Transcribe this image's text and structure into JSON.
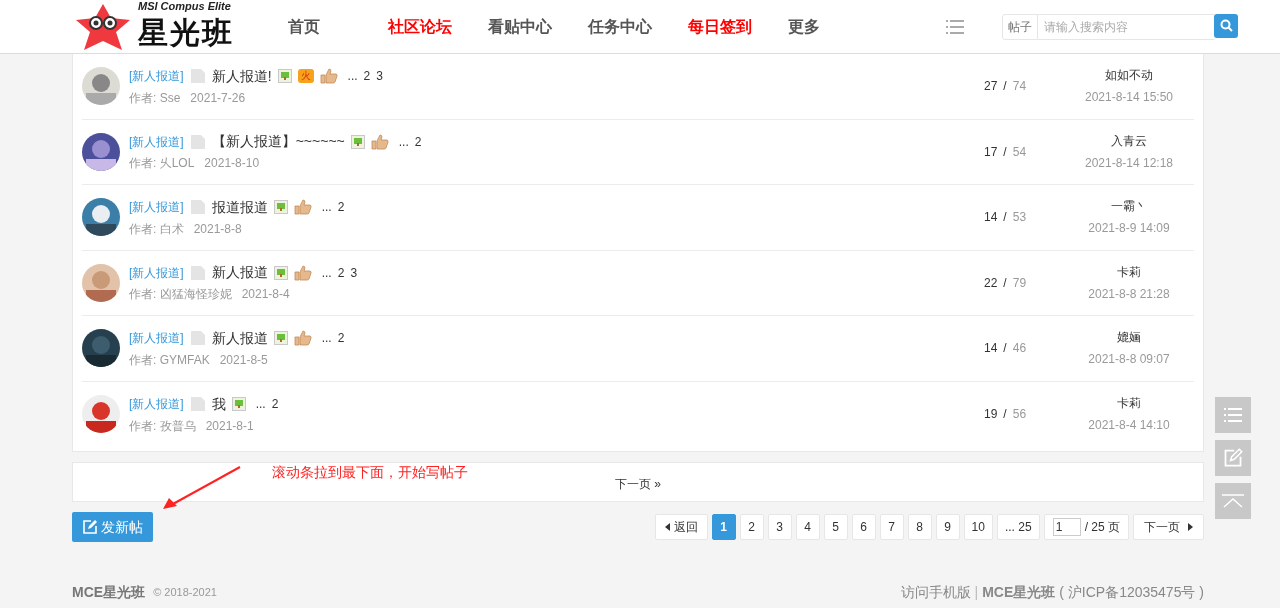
{
  "header": {
    "logo_caption": "MSI Compus Elite",
    "logo_title": "星光班",
    "nav": [
      {
        "label": "首页",
        "highlighted": false
      },
      {
        "label": "社区论坛",
        "highlighted": true
      },
      {
        "label": "看贴中心",
        "highlighted": false
      },
      {
        "label": "任务中心",
        "highlighted": false
      },
      {
        "label": "每日签到",
        "highlighted": true
      },
      {
        "label": "更多",
        "highlighted": false
      }
    ],
    "search": {
      "scope": "帖子",
      "placeholder": "请输入搜索内容"
    }
  },
  "threads": [
    {
      "category": "[新人报道]",
      "title": "新人报道!",
      "image": true,
      "hot": "火",
      "liked": true,
      "page_ellipsis": "...",
      "pages": [
        "2",
        "3"
      ],
      "author": "作者: Sse",
      "date": "2021-7-26",
      "replies": "27",
      "sep": "/",
      "views": "74",
      "last_poster": "如如不动",
      "last_time": "2021-8-14 15:50"
    },
    {
      "category": "[新人报道]",
      "title": "【新人报道】~~~~~~",
      "image": true,
      "liked": true,
      "page_ellipsis": "...",
      "pages": [
        "2"
      ],
      "author": "作者: 乆LOL",
      "date": "2021-8-10",
      "replies": "17",
      "sep": "/",
      "views": "54",
      "last_poster": "入青云",
      "last_time": "2021-8-14 12:18"
    },
    {
      "category": "[新人报道]",
      "title": "报道报道",
      "image": true,
      "liked": true,
      "page_ellipsis": "...",
      "pages": [
        "2"
      ],
      "author": "作者: 白术",
      "date": "2021-8-8",
      "replies": "14",
      "sep": "/",
      "views": "53",
      "last_poster": "一霸丶",
      "last_time": "2021-8-9 14:09"
    },
    {
      "category": "[新人报道]",
      "title": "新人报道",
      "image": true,
      "liked": true,
      "page_ellipsis": "...",
      "pages": [
        "2",
        "3"
      ],
      "author": "作者: 凶猛海怪珍妮",
      "date": "2021-8-4",
      "replies": "22",
      "sep": "/",
      "views": "79",
      "last_poster": "卡莉",
      "last_time": "2021-8-8 21:28"
    },
    {
      "category": "[新人报道]",
      "title": "新人报道",
      "image": true,
      "liked": true,
      "page_ellipsis": "...",
      "pages": [
        "2"
      ],
      "author": "作者: GYMFAK",
      "date": "2021-8-5",
      "replies": "14",
      "sep": "/",
      "views": "46",
      "last_poster": "媲婳",
      "last_time": "2021-8-8 09:07"
    },
    {
      "category": "[新人报道]",
      "title": "我",
      "image": true,
      "liked": false,
      "page_ellipsis": "...",
      "pages": [
        "2"
      ],
      "author": "作者: 孜普乌",
      "date": "2021-8-1",
      "replies": "19",
      "sep": "/",
      "views": "56",
      "last_poster": "卡莉",
      "last_time": "2021-8-4 14:10"
    }
  ],
  "next_page_bar": "下一页 »",
  "annotation": "滚动条拉到最下面，开始写帖子",
  "new_post_button": "发新帖",
  "pagination": {
    "back": "返回",
    "pages": [
      {
        "label": "1",
        "selected": true
      },
      {
        "label": "2",
        "selected": false
      },
      {
        "label": "3",
        "selected": false
      },
      {
        "label": "4",
        "selected": false
      },
      {
        "label": "5",
        "selected": false
      },
      {
        "label": "6",
        "selected": false
      },
      {
        "label": "7",
        "selected": false
      },
      {
        "label": "8",
        "selected": false
      },
      {
        "label": "9",
        "selected": false
      },
      {
        "label": "10",
        "selected": false
      },
      {
        "label": "... 25",
        "selected": false
      }
    ],
    "page_input": "1",
    "total": "/ 25 页",
    "next": "下一页"
  },
  "footer": {
    "brand": "MCE星光班",
    "copyright": "© 2018-2021",
    "mobile_link": "访问手机版",
    "divider": "|",
    "brand_link": "MCE星光班",
    "icp": "( 沪ICP备12035475号 )"
  }
}
